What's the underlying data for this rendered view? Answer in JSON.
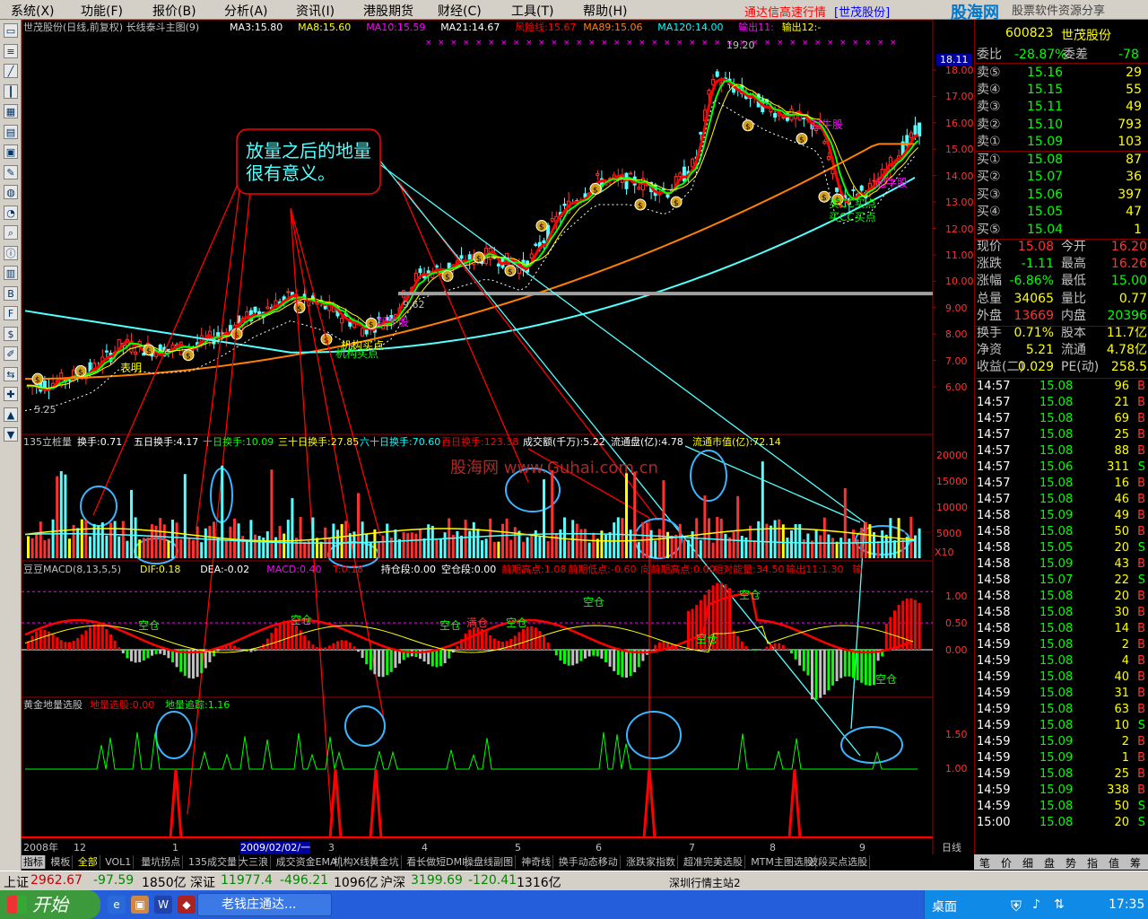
{
  "menu": {
    "items": [
      "系统(X)",
      "功能(F)",
      "报价(B)",
      "分析(A)",
      "资讯(I)",
      "港股期货",
      "财经(C)",
      "工具(T)",
      "帮助(H)"
    ],
    "title": "通达信高速行情",
    "stock": "[世茂股份]",
    "logo": "股海网",
    "logo_sub": "股票软件资源分享"
  },
  "lefttb": {
    "icons": [
      "window-icon",
      "list-icon",
      "line-chart-icon",
      "kline-icon",
      "table-icon",
      "news-icon",
      "calc-icon",
      "tool-icon",
      "map-icon",
      "pie-icon",
      "search-icon",
      "info-icon",
      "board-icon",
      "bsi-icon",
      "f10-icon",
      "dollar-icon",
      "pen-icon",
      "swap-icon",
      "plus-icon",
      "up-icon",
      "down-icon"
    ]
  },
  "main": {
    "title": "世茂股份(日线,前复权) 长线泰斗主图(9)",
    "ma": [
      {
        "t": "MA3:15.80",
        "c": "#ffffff"
      },
      {
        "t": "MA8:15.60",
        "c": "#ffff00"
      },
      {
        "t": "MA10:15.59",
        "c": "#ff00ff"
      },
      {
        "t": "MA21:14.67",
        "c": "#ffffff"
      },
      {
        "t": "风险线:15.67",
        "c": "#ff0000"
      },
      {
        "t": "MA89:15.06",
        "c": "#ff8000"
      },
      {
        "t": "MA120:14.00",
        "c": "#00ffff"
      },
      {
        "t": "输出11:",
        "c": "#ff00ff"
      },
      {
        "t": "输出12:-",
        "c": "#ffff00"
      }
    ],
    "yaxis": [
      "18.00",
      "17.00",
      "16.00",
      "15.00",
      "14.00",
      "13.00",
      "12.00",
      "11.00",
      "10.00",
      "9.00",
      "8.00",
      "7.00",
      "6.00"
    ],
    "yaxis_top": "18.11",
    "hi_label": "19.20",
    "lo_label": "5.25",
    "mid_label": "9.62",
    "annotation": "放量之后的地量很有意义。",
    "tags": [
      "起牛股",
      "起牛股",
      "起牛股",
      "表明",
      "机构买点",
      "买CC买点",
      "买CC买点",
      "机构买点"
    ]
  },
  "vol": {
    "title": "135立桩量",
    "items": [
      {
        "t": "换手:0.71",
        "c": "#ffffff"
      },
      {
        "t": "五日换手:4.17",
        "c": "#ffffff"
      },
      {
        "t": "十日换手:10.09",
        "c": "#00ff00"
      },
      {
        "t": "三十日换手:27.85",
        "c": "#ffff00"
      },
      {
        "t": "六十日换手:70.60",
        "c": "#00ffff"
      },
      {
        "t": "百日换手:123.38",
        "c": "#ff0000"
      },
      {
        "t": "成交额(千万):5.22",
        "c": "#ffffff"
      },
      {
        "t": "流通盘(亿):4.78",
        "c": "#ffffff"
      },
      {
        "t": "流通市值(亿):72.14",
        "c": "#ffff00"
      }
    ],
    "yaxis": [
      "20000",
      "15000",
      "10000",
      "5000"
    ],
    "unit": "X10",
    "watermark": "股海网 www.Guhai.com.cn"
  },
  "macd": {
    "title": "豆豆MACD(8,13,5,5)",
    "items": [
      {
        "t": "DIF:0.18",
        "c": "#ffff00"
      },
      {
        "t": "DEA:-0.02",
        "c": "#ffffff"
      },
      {
        "t": "MACD:0.40",
        "c": "#ff00ff"
      },
      {
        "t": "T:0.18",
        "c": "#ff0000"
      },
      {
        "t": "持仓段:0.00",
        "c": "#ffffff"
      },
      {
        "t": "空仓段:0.00",
        "c": "#ffffff"
      },
      {
        "t": "前期高点:1.08",
        "c": "#ff0000"
      },
      {
        "t": "前期低点:-0.60",
        "c": "#ff0000"
      },
      {
        "t": "向前期高点:0.00",
        "c": "#ff0000"
      },
      {
        "t": "相对能量:34.50",
        "c": "#ff0000"
      },
      {
        "t": "输出11:1.30",
        "c": "#ff0000"
      },
      {
        "t": "输",
        "c": "#ff0000"
      }
    ],
    "yaxis": [
      "1.00",
      "0.50",
      "0.00"
    ],
    "tags": [
      "空仓",
      "空仓",
      "空仓",
      "满仓",
      "空仓",
      "空仓",
      "空仓",
      "空仓",
      "空仓"
    ]
  },
  "gold": {
    "title": "黄金地量选股",
    "items": [
      {
        "t": "地量选股:0.00",
        "c": "#ff0000"
      },
      {
        "t": "地量追踪:1.16",
        "c": "#00ff00"
      }
    ],
    "yaxis": [
      "1.50",
      "1.00"
    ]
  },
  "xaxis": {
    "labels": [
      "2008年",
      "12",
      "1",
      "2009/02/02/一",
      "3",
      "4",
      "5",
      "6",
      "7",
      "8",
      "9"
    ],
    "period": "日线"
  },
  "tabs": [
    "指标",
    "模板",
    "全部",
    "VOL1",
    "量坑拐点",
    "135成交量",
    "大三浪",
    "成交资金EMA",
    "机构X线",
    "黄金坑",
    "看长做短DMI",
    "操盘线副图",
    "神奇线",
    "换手动态移动",
    "涨跌家指数",
    "超准完美选股",
    "MTM主图选股",
    "波段买点选股"
  ],
  "right": {
    "code": "600823",
    "name": "世茂股份",
    "webi": {
      "l1": "委比",
      "v1": "-28.87%",
      "l2": "委差",
      "v2": "-78"
    },
    "asks": [
      [
        "卖⑤",
        "15.16",
        "29"
      ],
      [
        "卖④",
        "15.15",
        "55"
      ],
      [
        "卖③",
        "15.11",
        "49"
      ],
      [
        "卖②",
        "15.10",
        "793"
      ],
      [
        "卖①",
        "15.09",
        "103"
      ]
    ],
    "bids": [
      [
        "买①",
        "15.08",
        "87"
      ],
      [
        "买②",
        "15.07",
        "36"
      ],
      [
        "买③",
        "15.06",
        "397"
      ],
      [
        "买④",
        "15.05",
        "47"
      ],
      [
        "买⑤",
        "15.04",
        "1"
      ]
    ],
    "quote": [
      [
        "现价",
        "15.08",
        "今开",
        "16.20"
      ],
      [
        "涨跌",
        "-1.11",
        "最高",
        "16.26"
      ],
      [
        "涨幅",
        "-6.86%",
        "最低",
        "15.00"
      ],
      [
        "总量",
        "34065",
        "量比",
        "0.77"
      ],
      [
        "外盘",
        "13669",
        "内盘",
        "20396"
      ],
      [
        "换手",
        "0.71%",
        "股本",
        "11.7亿"
      ],
      [
        "净资",
        "5.21",
        "流通",
        "4.78亿"
      ],
      [
        "收益(二)",
        "0.029",
        "PE(动)",
        "258.5"
      ]
    ],
    "ticks": [
      [
        "14:57",
        "15.08",
        "96",
        "B"
      ],
      [
        "14:57",
        "15.08",
        "21",
        "B"
      ],
      [
        "14:57",
        "15.08",
        "69",
        "B"
      ],
      [
        "14:57",
        "15.08",
        "25",
        "B"
      ],
      [
        "14:57",
        "15.08",
        "88",
        "B"
      ],
      [
        "14:57",
        "15.06",
        "311",
        "S"
      ],
      [
        "14:57",
        "15.08",
        "16",
        "B"
      ],
      [
        "14:57",
        "15.08",
        "46",
        "B"
      ],
      [
        "14:58",
        "15.09",
        "49",
        "B"
      ],
      [
        "14:58",
        "15.08",
        "50",
        "B"
      ],
      [
        "14:58",
        "15.05",
        "20",
        "S"
      ],
      [
        "14:58",
        "15.09",
        "43",
        "B"
      ],
      [
        "14:58",
        "15.07",
        "22",
        "S"
      ],
      [
        "14:58",
        "15.08",
        "20",
        "B"
      ],
      [
        "14:58",
        "15.08",
        "30",
        "B"
      ],
      [
        "14:58",
        "15.08",
        "14",
        "B"
      ],
      [
        "14:59",
        "15.08",
        "2",
        "B"
      ],
      [
        "14:59",
        "15.08",
        "4",
        "B"
      ],
      [
        "14:59",
        "15.08",
        "40",
        "B"
      ],
      [
        "14:59",
        "15.08",
        "31",
        "B"
      ],
      [
        "14:59",
        "15.08",
        "63",
        "B"
      ],
      [
        "14:59",
        "15.08",
        "10",
        "S"
      ],
      [
        "14:59",
        "15.09",
        "2",
        "B"
      ],
      [
        "14:59",
        "15.09",
        "1",
        "B"
      ],
      [
        "14:59",
        "15.08",
        "25",
        "B"
      ],
      [
        "14:59",
        "15.09",
        "338",
        "B"
      ],
      [
        "14:59",
        "15.08",
        "50",
        "S"
      ],
      [
        "15:00",
        "15.08",
        "20",
        "S"
      ]
    ],
    "tabs": [
      "笔",
      "价",
      "细",
      "盘",
      "势",
      "指",
      "值",
      "筹"
    ]
  },
  "status": {
    "sh_l": "上证",
    "sh_v": "2962.67",
    "sh_c": "-97.59",
    "sh_a": "1850亿",
    "sz_l": "深证",
    "sz_v": "11977.4",
    "sz_c": "-496.21",
    "sz_a": "1096亿",
    "hs_l": "沪深",
    "hs_v": "3199.69",
    "hs_c": "-120.41",
    "hs_a": "1316亿",
    "server": "深圳行情主站2"
  },
  "taskbar": {
    "start": "开始",
    "task": "老钱庄通达...",
    "desktop": "桌面",
    "time": "17:35"
  },
  "colors": {
    "up": "#ff3232",
    "down": "#54ffff",
    "yellow": "#ffff00",
    "grid": "#800000"
  }
}
